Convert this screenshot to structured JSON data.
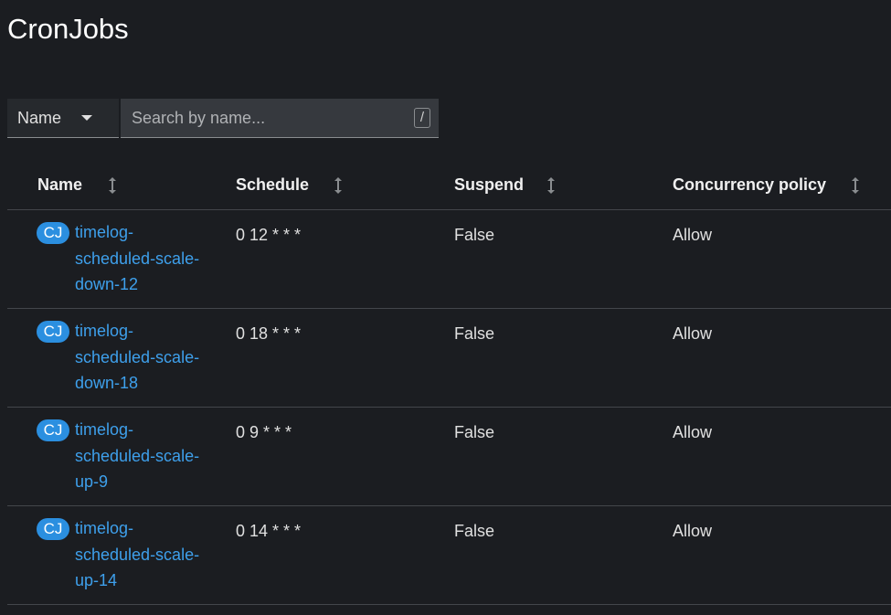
{
  "page": {
    "title": "CronJobs"
  },
  "filter": {
    "selected": "Name",
    "search_placeholder": "Search by name...",
    "shortcut": "/"
  },
  "table": {
    "columns": [
      "Name",
      "Schedule",
      "Suspend",
      "Concurrency policy"
    ],
    "rows": [
      {
        "badge": "CJ",
        "name": "timelog-\nscheduled-scale-\ndown-12",
        "schedule": "0 12 * * *",
        "suspend": "False",
        "concurrency": "Allow"
      },
      {
        "badge": "CJ",
        "name": "timelog-\nscheduled-scale-\ndown-18",
        "schedule": "0 18 * * *",
        "suspend": "False",
        "concurrency": "Allow"
      },
      {
        "badge": "CJ",
        "name": "timelog-\nscheduled-scale-\nup-9",
        "schedule": "0 9 * * *",
        "suspend": "False",
        "concurrency": "Allow"
      },
      {
        "badge": "CJ",
        "name": "timelog-\nscheduled-scale-\nup-14",
        "schedule": "0 14 * * *",
        "suspend": "False",
        "concurrency": "Allow"
      }
    ]
  },
  "colors": {
    "background": "#1b1d21",
    "link": "#3ea0ec",
    "badge": "#2b8fe0",
    "divider": "#43464b"
  },
  "icons": {
    "sort": "sort-icon",
    "dropdown": "caret-down-icon"
  }
}
